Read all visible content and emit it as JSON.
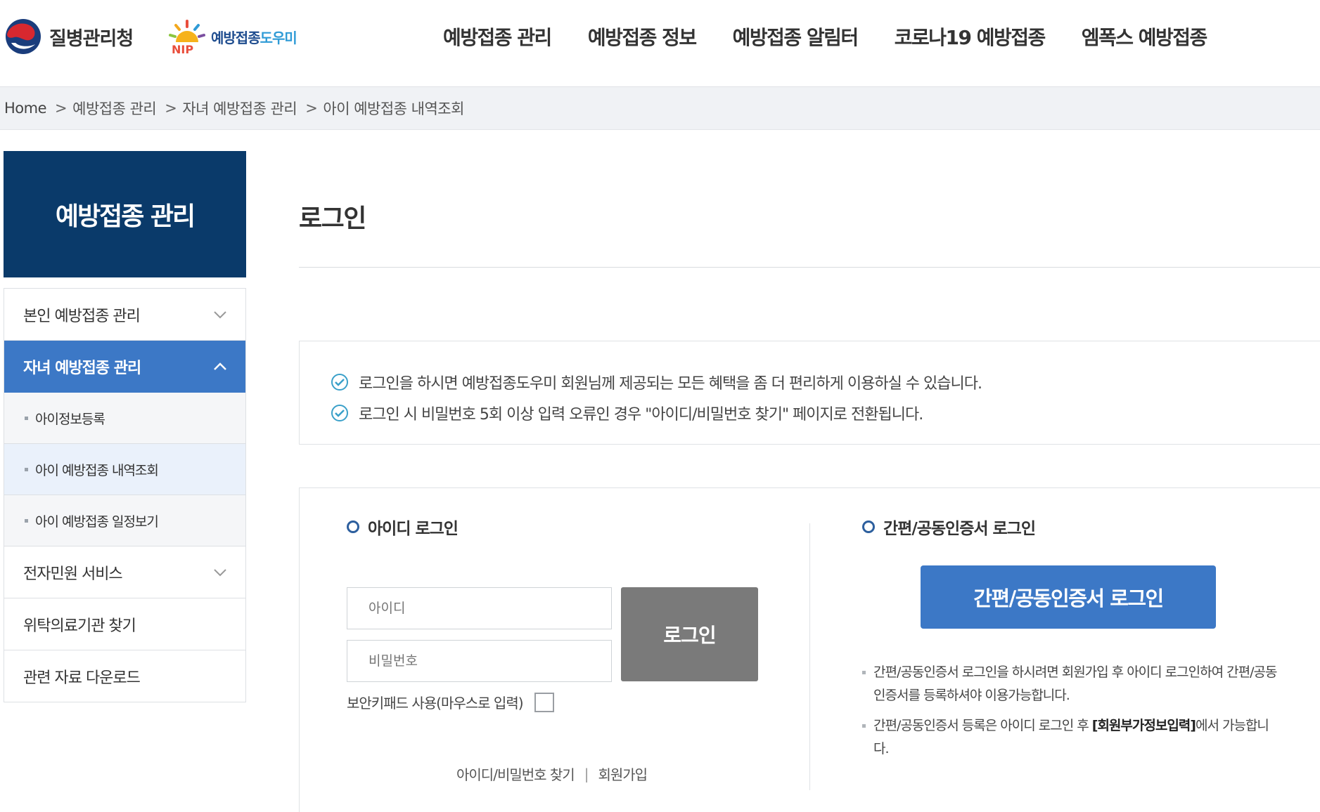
{
  "header": {
    "kdca_name": "질병관리청",
    "nip_name_a": "예방접종",
    "nip_name_b": "도우미",
    "nip_letters": "NIP",
    "nav": [
      "예방접종 관리",
      "예방접종 정보",
      "예방접종 알림터",
      "코로나19 예방접종",
      "엠폭스 예방접종"
    ]
  },
  "breadcrumb": {
    "home": "Home",
    "sep": ">",
    "items": [
      "예방접종 관리",
      "자녀 예방접종 관리",
      "아이 예방접종 내역조회"
    ]
  },
  "sidebar": {
    "title": "예방접종 관리",
    "items": [
      {
        "label": "본인 예방접종 관리"
      },
      {
        "label": "자녀 예방접종 관리"
      },
      {
        "label": "아이정보등록"
      },
      {
        "label": "아이 예방접종 내역조회"
      },
      {
        "label": "아이 예방접종 일정보기"
      },
      {
        "label": "전자민원 서비스"
      },
      {
        "label": "위탁의료기관 찾기"
      },
      {
        "label": "관련 자료 다운로드"
      }
    ]
  },
  "main": {
    "title": "로그인",
    "notices": [
      "로그인을 하시면 예방접종도우미 회원님께 제공되는 모든 혜택을 좀 더 편리하게 이용하실 수 있습니다.",
      "로그인 시 비밀번호 5회 이상 입력 오류인 경우 \"아이디/비밀번호 찾기\" 페이지로 전환됩니다."
    ],
    "id_login": {
      "title": "아이디 로그인",
      "id_placeholder": "아이디",
      "pw_placeholder": "비밀번호",
      "login_label": "로그인",
      "keypad_label": "보안키패드 사용(마우스로 입력)",
      "find_link": "아이디/비밀번호 찾기",
      "link_sep": "|",
      "join_link": "회원가입"
    },
    "cert_login": {
      "title": "간편/공동인증서 로그인",
      "button_label": "간편/공동인증서 로그인",
      "note1": "간편/공동인증서 로그인을 하시려면 회원가입 후 아이디 로그인하여 간편/공동인증서를 등록하셔야 이용가능합니다.",
      "note2_pre": "간편/공동인증서 등록은 아이디 로그인 후 ",
      "note2_bold": "[회원부가정보입력]",
      "note2_post": "에서 가능합니다."
    }
  },
  "colors": {
    "sidebar_title_bg": "#0a3a6a",
    "active_blue": "#3c78c6",
    "login_button_gray": "#7a7a7a"
  }
}
